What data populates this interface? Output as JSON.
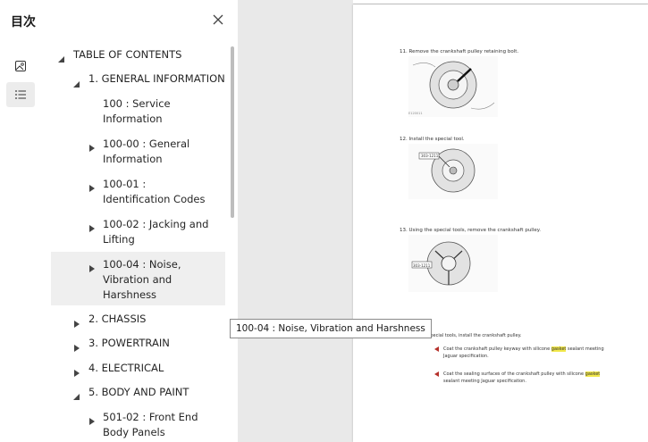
{
  "sidebar": {
    "title": "目次",
    "close_icon": "close-icon",
    "rail": [
      {
        "icon": "image-icon"
      },
      {
        "icon": "list-icon",
        "active": true
      }
    ],
    "toc": [
      {
        "label": "TABLE OF CONTENTS",
        "expanded": true
      },
      {
        "label": "1. GENERAL INFORMATION",
        "expanded": true
      },
      {
        "label": "100 : Service Information"
      },
      {
        "label": "100-00 : General Information"
      },
      {
        "label": "100-01 : Identification Codes"
      },
      {
        "label": "100-02 : Jacking and Lifting"
      },
      {
        "label": "100-04 : Noise, Vibration and Harshness",
        "hovered": true
      },
      {
        "label": "2. CHASSIS"
      },
      {
        "label": "3. POWERTRAIN"
      },
      {
        "label": "4. ELECTRICAL"
      },
      {
        "label": "5. BODY AND PAINT",
        "expanded": true
      },
      {
        "label": "501-02 : Front End Body Panels"
      }
    ]
  },
  "tooltip": "100-04 : Noise, Vibration and Harshness",
  "document": {
    "step1": "11. Remove the crankshaft pulley retaining bolt.",
    "step2": "12. Install the special tool.",
    "step2_tool": "303-1211",
    "step3": "13. Using the special tools, remove the crankshaft pulley.",
    "step3_tool": "303-1211",
    "install_heading": "allation",
    "install_step": "1. Using the special tools, install the crankshaft pulley.",
    "note1_pre": "Coat the crankshaft pulley keyway with silicone",
    "note1_hl": "gasket",
    "note1_post": "sealant meeting",
    "note1_line2": "Jaguar specification.",
    "note2_pre": "Coat the sealing surfaces of the crankshaft pulley with silicone",
    "note2_hl": "gasket",
    "note2_line2": "sealant meeting Jaguar specification."
  }
}
